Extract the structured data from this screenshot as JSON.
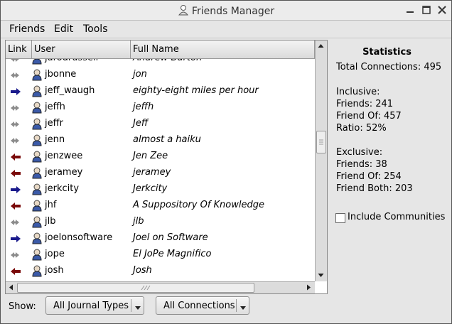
{
  "window": {
    "title": "Friends Manager"
  },
  "menu": {
    "friends": "Friends",
    "edit": "Edit",
    "tools": "Tools"
  },
  "columns": {
    "link": "Link",
    "user": "User",
    "fullname": "Full Name"
  },
  "rows": [
    {
      "user": "jarodrussell",
      "fullname": "Andrew Burton",
      "link": "mutual"
    },
    {
      "user": "jbonne",
      "fullname": "jon",
      "link": "mutual"
    },
    {
      "user": "jeff_waugh",
      "fullname": "eighty-eight miles per hour",
      "link": "friend"
    },
    {
      "user": "jeffh",
      "fullname": "jeffh",
      "link": "mutual"
    },
    {
      "user": "jeffr",
      "fullname": "Jeff",
      "link": "mutual"
    },
    {
      "user": "jenn",
      "fullname": "almost a haiku",
      "link": "mutual"
    },
    {
      "user": "jenzwee",
      "fullname": "Jen Zee",
      "link": "friend-of"
    },
    {
      "user": "jeramey",
      "fullname": "jeramey",
      "link": "friend-of"
    },
    {
      "user": "jerkcity",
      "fullname": "Jerkcity",
      "link": "friend"
    },
    {
      "user": "jhf",
      "fullname": "A Suppository Of Knowledge",
      "link": "friend-of"
    },
    {
      "user": "jlb",
      "fullname": "jlb",
      "link": "mutual"
    },
    {
      "user": "joelonsoftware",
      "fullname": "Joel on Software",
      "link": "friend"
    },
    {
      "user": "jope",
      "fullname": "El JoPe Magnifico",
      "link": "mutual"
    },
    {
      "user": "josh",
      "fullname": "Josh",
      "link": "friend-of"
    }
  ],
  "stats": {
    "title": "Statistics",
    "total": "Total Connections: 495",
    "inclusive_header": "Inclusive:",
    "inclusive_friends": "Friends: 241",
    "inclusive_friend_of": "Friend Of: 457",
    "inclusive_ratio": "Ratio: 52%",
    "exclusive_header": "Exclusive:",
    "exclusive_friends": "Friends: 38",
    "exclusive_friend_of": "Friend Of: 254",
    "exclusive_both": "Friend Both: 203"
  },
  "include_communities": "Include Communities",
  "bottom": {
    "show_label": "Show:",
    "journal_types": "All Journal Types",
    "connections": "All Connections"
  },
  "colors": {
    "mutual": "#8c8c8c",
    "friend": "#1a1a8c",
    "friend_of": "#7a0a0a"
  },
  "icons": {
    "link_mutual": "double-arrow-icon",
    "link_friend": "right-arrow-icon",
    "link_friend_of": "left-arrow-icon",
    "user": "user-icon"
  }
}
